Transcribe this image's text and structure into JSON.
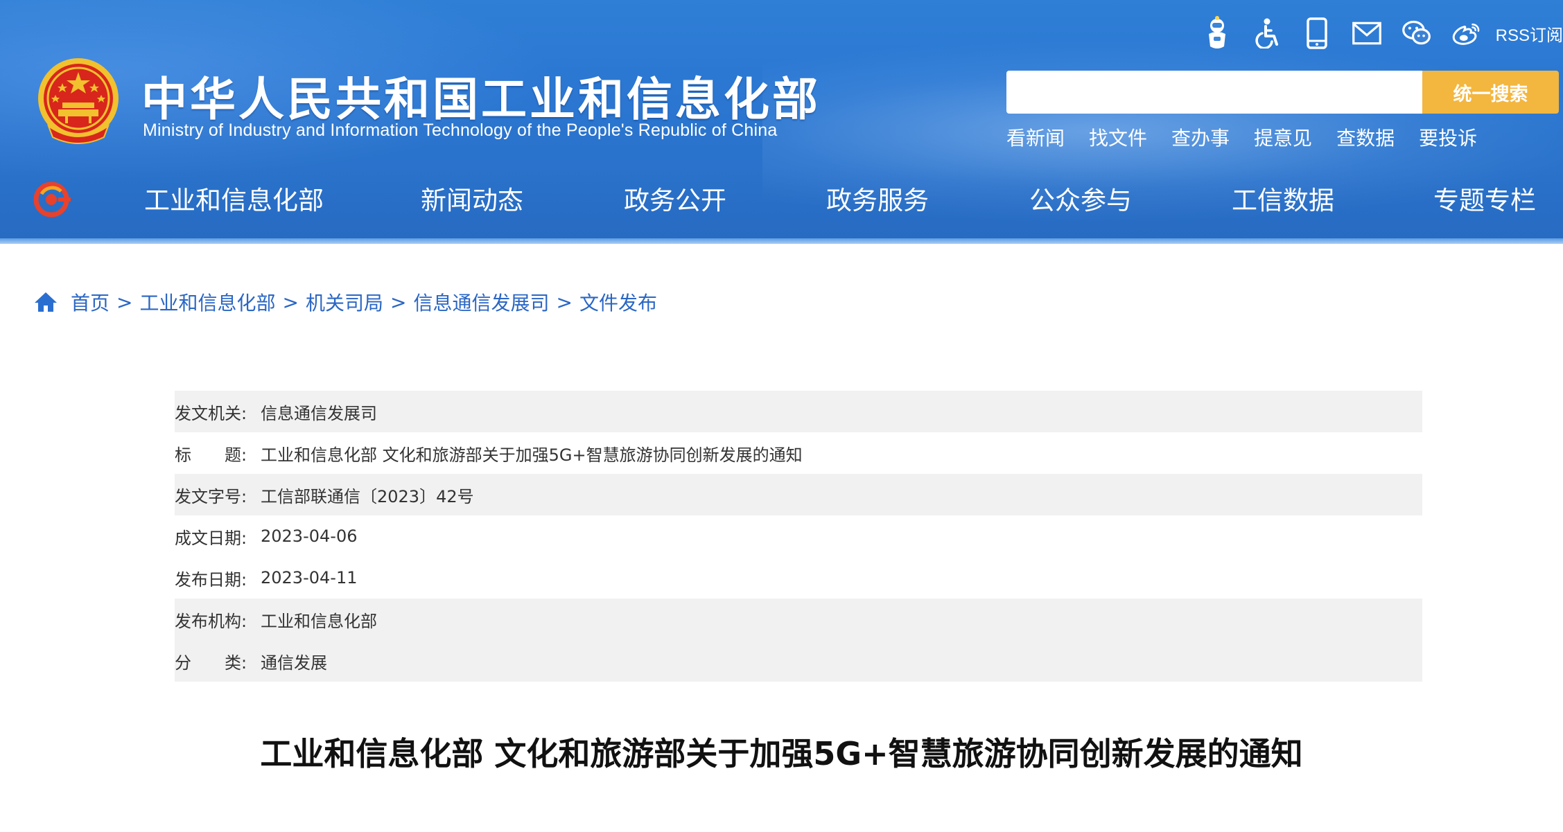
{
  "site": {
    "title": "中华人民共和国工业和信息化部",
    "subtitle": "Ministry of Industry and Information Technology of the People's Republic of China"
  },
  "top_icons": {
    "items": [
      "robot-assistant-icon",
      "accessibility-icon",
      "mobile-icon",
      "mail-icon",
      "wechat-icon",
      "weibo-icon"
    ],
    "rss_label": "RSS订阅"
  },
  "search": {
    "placeholder": "",
    "button_label": "统一搜索"
  },
  "quick_links": [
    "看新闻",
    "找文件",
    "查办事",
    "提意见",
    "查数据",
    "要投诉"
  ],
  "nav": [
    "工业和信息化部",
    "新闻动态",
    "政务公开",
    "政务服务",
    "公众参与",
    "工信数据",
    "专题专栏"
  ],
  "breadcrumb": [
    "首页",
    "工业和信息化部",
    "机关司局",
    "信息通信发展司",
    "文件发布"
  ],
  "breadcrumb_sep": ">",
  "meta": [
    {
      "label": "发文机关:",
      "value": "信息通信发展司"
    },
    {
      "label": "标　　题:",
      "value": "工业和信息化部 文化和旅游部关于加强5G+智慧旅游协同创新发展的通知"
    },
    {
      "label": "发文字号:",
      "value": "工信部联通信〔2023〕42号"
    },
    {
      "label": "成文日期:",
      "value": "2023-04-06"
    },
    {
      "label": "发布日期:",
      "value": "2023-04-11"
    },
    {
      "label": "发布机构:",
      "value": "工业和信息化部"
    },
    {
      "label": "分　　类:",
      "value": "通信发展"
    }
  ],
  "article": {
    "title": "工业和信息化部 文化和旅游部关于加强5G+智慧旅游协同创新发展的通知"
  },
  "colors": {
    "header_blue": "#2b78d3",
    "search_button": "#f3b63f",
    "link_blue": "#2a66c4",
    "meta_shade": "#f1f1f1"
  }
}
